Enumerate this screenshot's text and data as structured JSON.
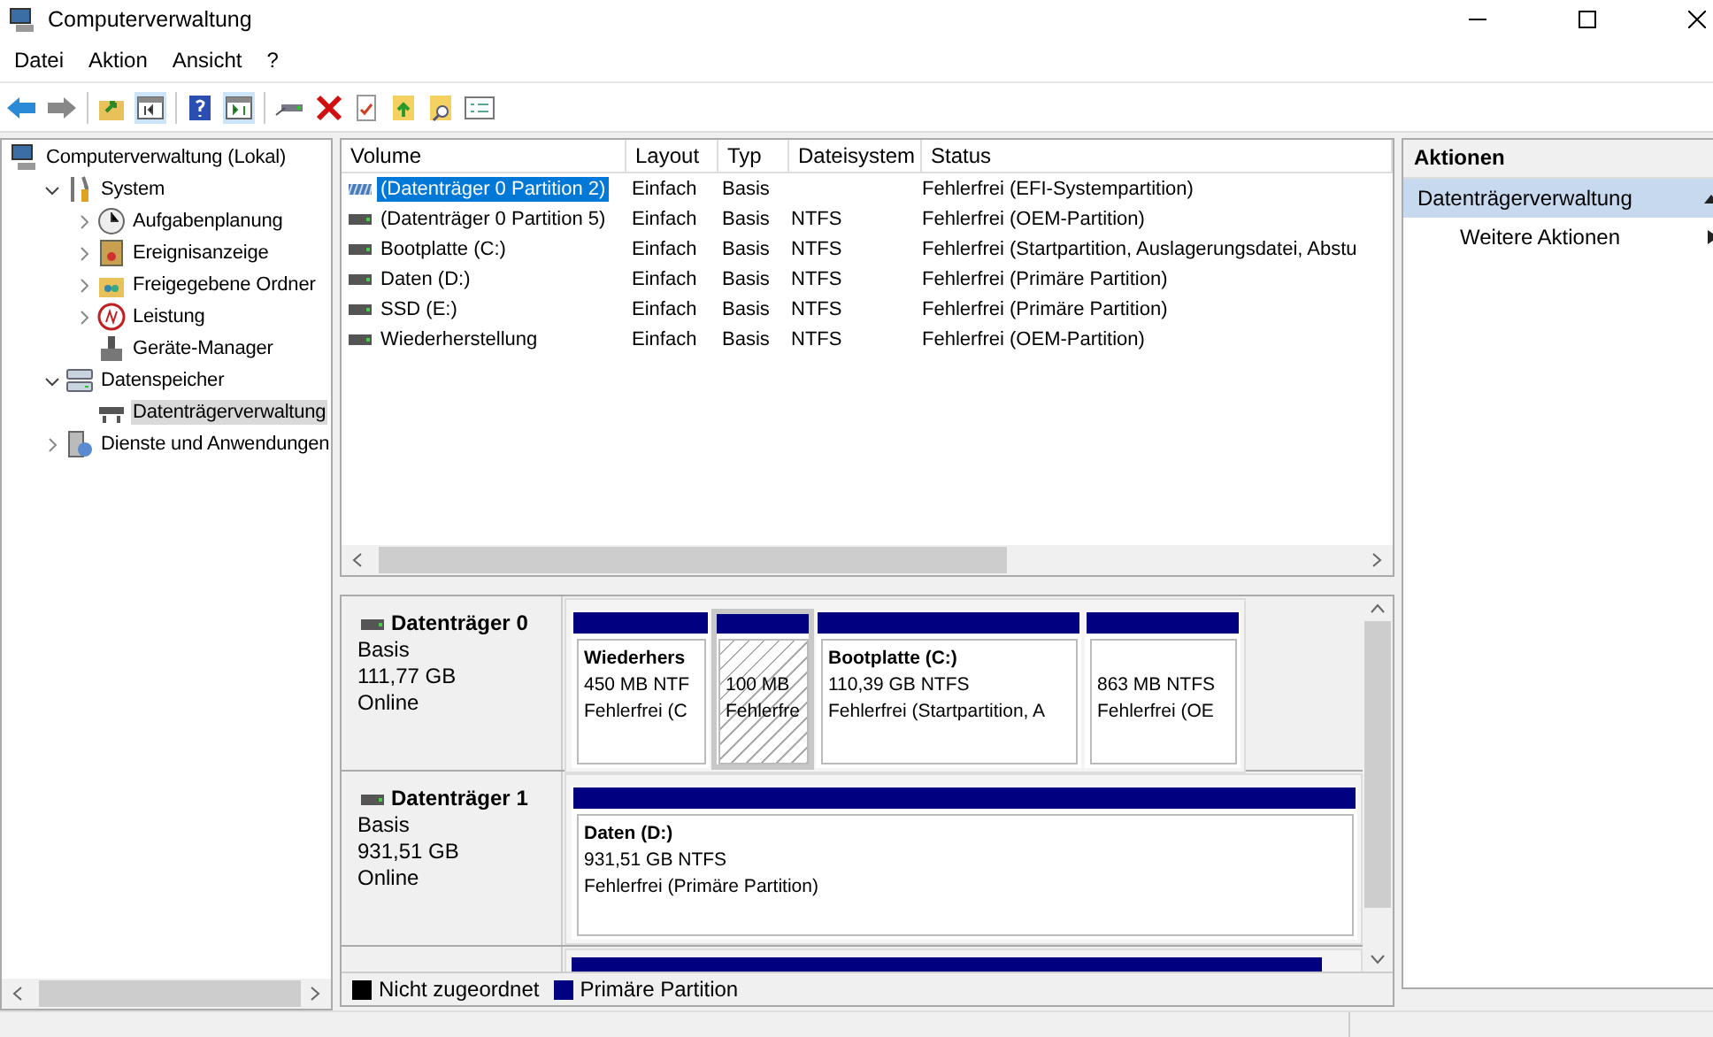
{
  "window": {
    "title": "Computerverwaltung"
  },
  "menu": [
    "Datei",
    "Aktion",
    "Ansicht",
    "?"
  ],
  "tree": [
    {
      "label": "Computerverwaltung (Lokal)",
      "kind": "root",
      "selected": false,
      "children": [
        {
          "label": "System",
          "kind": "folder",
          "expanded": true,
          "selected": false,
          "children": [
            {
              "label": "Aufgabenplanung",
              "kind": "folder",
              "expanded": false,
              "selected": false
            },
            {
              "label": "Ereignisanzeige",
              "kind": "folder",
              "expanded": false,
              "selected": false
            },
            {
              "label": "Freigegebene Ordner",
              "kind": "folder",
              "expanded": false,
              "selected": false
            },
            {
              "label": "Leistung",
              "kind": "folder",
              "expanded": false,
              "selected": false
            },
            {
              "label": "Geräte-Manager",
              "kind": "leaf",
              "selected": false
            }
          ]
        },
        {
          "label": "Datenspeicher",
          "kind": "folder",
          "expanded": true,
          "selected": false,
          "children": [
            {
              "label": "Datenträgerverwaltung",
              "kind": "leaf",
              "selected": true
            }
          ]
        },
        {
          "label": "Dienste und Anwendungen",
          "kind": "folder",
          "expanded": false,
          "selected": false
        }
      ]
    }
  ],
  "table": {
    "columns": [
      "Volume",
      "Layout",
      "Typ",
      "Dateisystem",
      "Status"
    ],
    "rows": [
      {
        "volume": "(Datenträger 0 Partition 2)",
        "layout": "Einfach",
        "type": "Basis",
        "filesystem": "",
        "status": "Fehlerfrei (EFI-Systempartition)",
        "kind": "system",
        "selected": true
      },
      {
        "volume": "(Datenträger 0 Partition 5)",
        "layout": "Einfach",
        "type": "Basis",
        "filesystem": "NTFS",
        "status": "Fehlerfrei (OEM-Partition)",
        "kind": "primary",
        "selected": false
      },
      {
        "volume": "Bootplatte (C:)",
        "layout": "Einfach",
        "type": "Basis",
        "filesystem": "NTFS",
        "status": "Fehlerfrei (Startpartition, Auslagerungsdatei, Abstu",
        "kind": "primary",
        "selected": false
      },
      {
        "volume": "Daten (D:)",
        "layout": "Einfach",
        "type": "Basis",
        "filesystem": "NTFS",
        "status": "Fehlerfrei (Primäre Partition)",
        "kind": "primary",
        "selected": false
      },
      {
        "volume": "SSD (E:)",
        "layout": "Einfach",
        "type": "Basis",
        "filesystem": "NTFS",
        "status": "Fehlerfrei (Primäre Partition)",
        "kind": "primary",
        "selected": false
      },
      {
        "volume": "Wiederherstellung",
        "layout": "Einfach",
        "type": "Basis",
        "filesystem": "NTFS",
        "status": "Fehlerfrei (OEM-Partition)",
        "kind": "primary",
        "selected": false
      }
    ]
  },
  "disks": [
    {
      "name": "Datenträger 0",
      "type": "Basis",
      "size": "111,77 GB",
      "state": "Online",
      "partitions": [
        {
          "name": "Wiederhers",
          "size": "450 MB NTF",
          "status": "Fehlerfrei (C",
          "kind": "primary",
          "selected": false
        },
        {
          "size": "100 MB",
          "status": "Fehlerfre",
          "kind": "system",
          "selected": true
        },
        {
          "name": "Bootplatte  (C:)",
          "size": "110,39 GB NTFS",
          "status": "Fehlerfrei (Startpartition, A",
          "kind": "primary",
          "selected": false
        },
        {
          "size": "863 MB NTFS",
          "status": "Fehlerfrei (OE",
          "kind": "primary",
          "selected": false
        }
      ]
    },
    {
      "name": "Datenträger 1",
      "type": "Basis",
      "size": "931,51 GB",
      "state": "Online",
      "partitions": [
        {
          "name": "Daten  (D:)",
          "size": "931,51 GB NTFS",
          "status": "Fehlerfrei (Primäre Partition)",
          "kind": "primary",
          "selected": false
        }
      ]
    }
  ],
  "legend": [
    {
      "label": "Nicht zugeordnet",
      "color": "#000000"
    },
    {
      "label": "Primäre Partition",
      "color": "#000080"
    }
  ],
  "actions": {
    "title": "Aktionen",
    "section": "Datenträgerverwaltung",
    "items": [
      "Weitere Aktionen"
    ]
  }
}
